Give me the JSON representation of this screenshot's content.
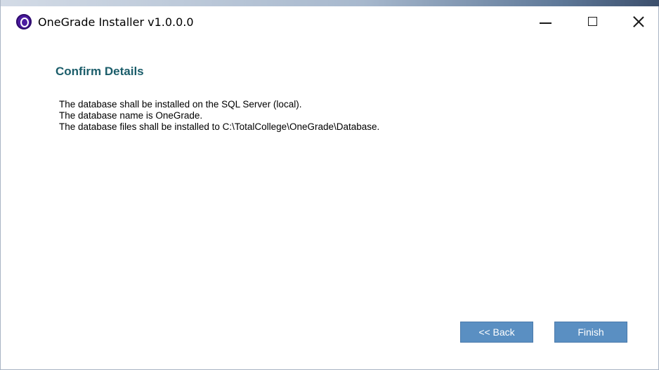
{
  "window": {
    "title": "OneGrade Installer v1.0.0.0"
  },
  "titlebar": {
    "icon": "onegrade-app-icon",
    "controls": [
      "minimize-icon",
      "maximize-icon",
      "close-icon"
    ]
  },
  "page": {
    "title": "Confirm Details",
    "lines": [
      "The database shall be installed on the SQL Server (local).",
      "The database name is OneGrade.",
      "The database files shall be installed to C:\\TotalCollege\\OneGrade\\Database."
    ]
  },
  "buttons": {
    "back_label": "<< Back",
    "finish_label": "Finish"
  },
  "colors": {
    "heading": "#1b5d6a",
    "button_bg": "#5a8fc2",
    "app_icon": "#4b1aa0"
  }
}
